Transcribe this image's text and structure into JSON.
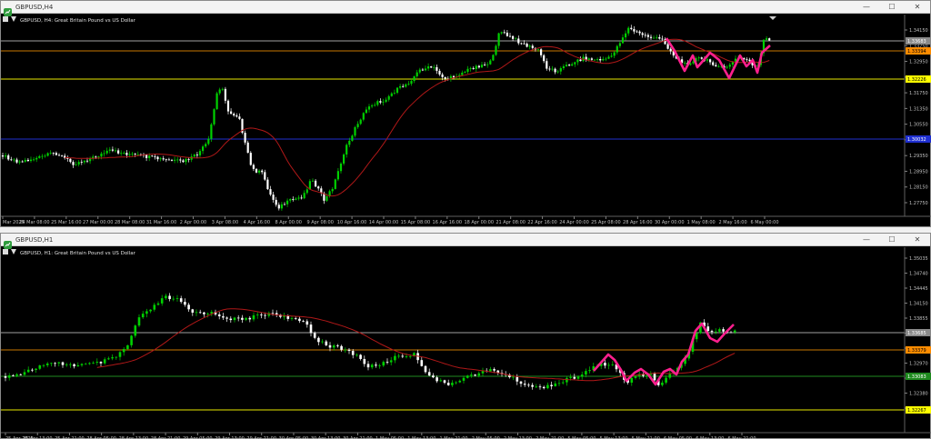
{
  "windows": [
    {
      "title": "GBPUSD,H4",
      "label": "GBPUSD, H4:  Great Britain Pound vs US Dollar",
      "y_ticks": [
        "1.34150",
        "1.33750",
        "1.32950",
        "1.32550",
        "1.31750",
        "1.31350",
        "1.30550",
        "1.30150",
        "1.29350",
        "1.28950",
        "1.28150",
        "1.27750"
      ],
      "levels": [
        {
          "price": "1.33683",
          "line": "#a0a0a0",
          "box": "#8a8a8a",
          "text": "#ffffff"
        },
        {
          "price": "1.33394",
          "line": "#c87800",
          "box": "#ff8c00",
          "text": "#000000"
        },
        {
          "price": "1.32226",
          "line": "#e8e800",
          "box": "#ffff00",
          "text": "#000000"
        },
        {
          "price": "1.30032",
          "line": "#1f2fd0",
          "box": "#1f2fd0",
          "text": "#ffffff"
        }
      ],
      "x_ticks": [
        "Mar 2025",
        "24 Mar 08:00",
        "25 Mar 16:00",
        "27 Mar 00:00",
        "28 Mar 08:00",
        "31 Mar 16:00",
        "2 Apr 00:00",
        "3 Apr 08:00",
        "4 Apr 16:00",
        "8 Apr 00:00",
        "9 Apr 08:00",
        "10 Apr 16:00",
        "14 Apr 00:00",
        "15 Apr 08:00",
        "16 Apr 16:00",
        "18 Apr 00:00",
        "21 Apr 08:00",
        "22 Apr 16:00",
        "24 Apr 00:00",
        "25 Apr 08:00",
        "28 Apr 16:00",
        "30 Apr 00:00",
        "1 May 08:00",
        "2 May 16:00",
        "6 May 00:00"
      ]
    },
    {
      "title": "GBPUSD,H1",
      "label": "GBPUSD, H1:  Great Britain Pound vs US Dollar",
      "y_ticks": [
        "1.35035",
        "1.34740",
        "1.34445",
        "1.34150",
        "1.33855",
        "1.33560",
        "1.33265",
        "1.32970",
        "1.32675",
        "1.32380",
        "1.32085"
      ],
      "levels": [
        {
          "price": "1.33685",
          "line": "#a0a0a0",
          "box": "#8a8a8a",
          "text": "#ffffff"
        },
        {
          "price": "1.33379",
          "line": "#c87800",
          "box": "#ff8c00",
          "text": "#000000"
        },
        {
          "price": "1.33083",
          "line": "#1f8a1f",
          "box": "#1f8a1f",
          "text": "#ffffff"
        },
        {
          "price": "1.32267",
          "line": "#e8e800",
          "box": "#ffff00",
          "text": "#000000"
        }
      ],
      "x_ticks": [
        "25 Apr 2025",
        "25 Apr 13:00",
        "25 Apr 21:00",
        "28 Apr 05:00",
        "28 Apr 13:00",
        "28 Apr 21:00",
        "29 Apr 05:00",
        "29 Apr 13:00",
        "29 Apr 21:00",
        "30 Apr 05:00",
        "30 Apr 13:00",
        "30 Apr 21:00",
        "1 May 05:00",
        "1 May 13:00",
        "1 May 21:00",
        "2 May 05:00",
        "2 May 13:00",
        "2 May 21:00",
        "5 May 05:00",
        "5 May 13:00",
        "5 May 21:00",
        "6 May 05:00",
        "6 May 13:00",
        "6 May 21:00"
      ]
    }
  ],
  "window_controls": {
    "minimize": "—",
    "maximize": "☐",
    "close": "✕"
  },
  "colors": {
    "bull": "#00d000",
    "bear": "#ffffff",
    "ma": "#b01818",
    "zigzag": "#ff1f8e",
    "background": "#000000",
    "axis_text": "#c0c0c0"
  }
}
